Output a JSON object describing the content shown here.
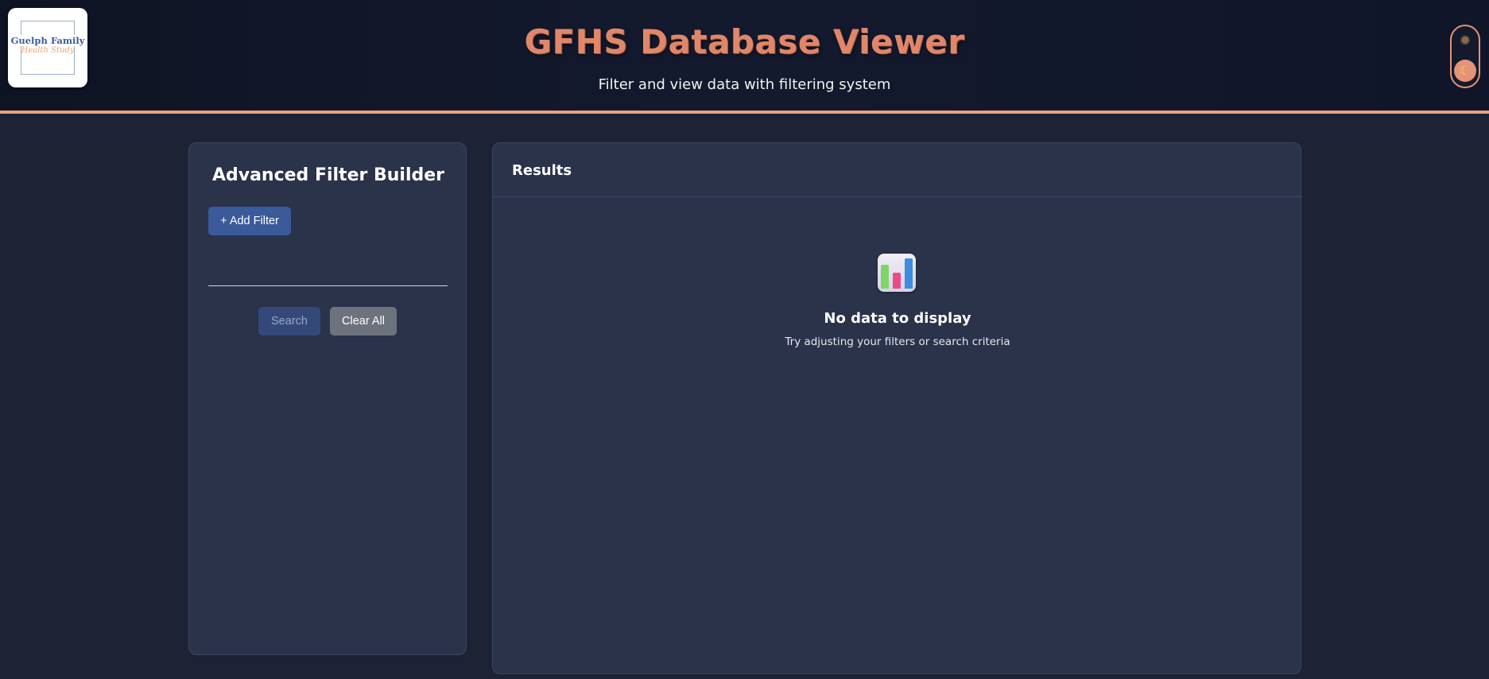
{
  "header": {
    "logo": {
      "line1": "Guelph Family",
      "line2": "Health Study"
    },
    "title": "GFHS Database Viewer",
    "subtitle": "Filter and view data with filtering system",
    "theme_toggle": {
      "light_icon": "sun-icon",
      "dark_icon": "moon-icon",
      "active": "dark"
    }
  },
  "filter_panel": {
    "title": "Advanced Filter Builder",
    "add_filter_label": "+ Add Filter",
    "search_label": "Search",
    "clear_label": "Clear All"
  },
  "results": {
    "title": "Results",
    "empty_icon": "bar-chart-icon",
    "empty_title": "No data to display",
    "empty_subtitle": "Try adjusting your filters or search criteria"
  },
  "colors": {
    "accent": "#e0876a",
    "background": "#1d2235",
    "panel": "#2a334a",
    "primary_button": "#3a5a9a",
    "secondary_button": "#6c727e"
  }
}
